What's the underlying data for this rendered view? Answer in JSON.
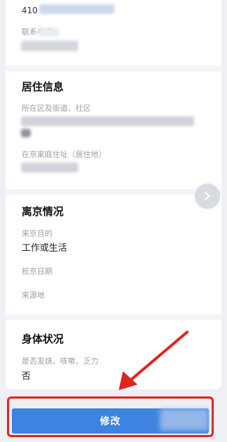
{
  "contact": {
    "id_prefix": "410",
    "phone_label": "联系电话"
  },
  "residence": {
    "title": "居住信息",
    "district_label": "所在区及街道、社区",
    "address_label": "在京家庭住址（居住地）"
  },
  "departure": {
    "title": "离京情况",
    "purpose_label": "来京目的",
    "purpose_value": "工作或生活",
    "arrival_date_label": "抵京日期",
    "origin_label": "来源地"
  },
  "health": {
    "title": "身体状况",
    "symptoms_label": "是否发烧、咳嗽、乏力",
    "symptoms_value": "否"
  },
  "actions": {
    "modify_label": "修改"
  },
  "colors": {
    "primary_button": "#3d83df",
    "highlight_red": "#e0241e",
    "page_background": "#eef0f5"
  },
  "icons": {
    "next": "chevron-right-icon"
  }
}
